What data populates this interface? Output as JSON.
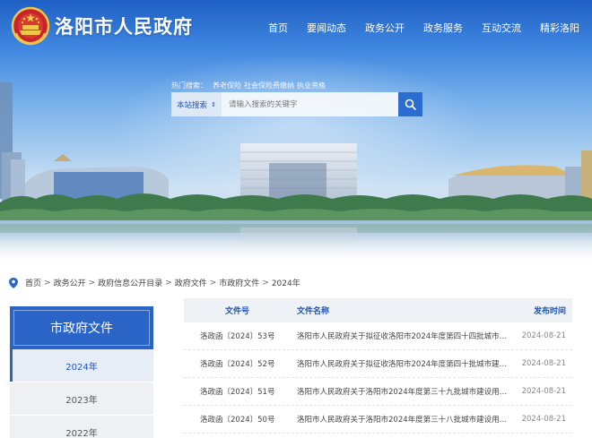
{
  "header": {
    "site_title": "洛阳市人民政府",
    "logo_icon": "national-emblem-icon",
    "nav": [
      "首页",
      "要闻动态",
      "政务公开",
      "政务服务",
      "互动交流",
      "精彩洛阳"
    ]
  },
  "search": {
    "hot_label": "热门搜索：",
    "hot_links": [
      "养老保险",
      "社会保险费缴纳",
      "执业资格"
    ],
    "scope_label": "本站搜索",
    "placeholder": "请输入搜索的关键字",
    "button_icon": "search-icon"
  },
  "breadcrumb": {
    "icon": "location-pin-icon",
    "items": [
      "首页",
      "政务公开",
      "政府信息公开目录",
      "政府文件",
      "市政府文件",
      "2024年"
    ],
    "separator": ">"
  },
  "sidebar": {
    "title": "市政府文件",
    "items": [
      {
        "label": "2024年",
        "active": true
      },
      {
        "label": "2023年",
        "active": false
      },
      {
        "label": "2022年",
        "active": false
      }
    ]
  },
  "table": {
    "headers": {
      "number": "文件号",
      "title": "文件名称",
      "date": "发布时间"
    },
    "rows": [
      {
        "number": "洛政函〔2024〕53号",
        "title": "洛阳市人民政府关于拟征收洛阳市2024年度第四十四批城市建...",
        "date": "2024-08-21"
      },
      {
        "number": "洛政函〔2024〕52号",
        "title": "洛阳市人民政府关于拟征收洛阳市2024年度第四十批城市建设...",
        "date": "2024-08-21"
      },
      {
        "number": "洛政函〔2024〕51号",
        "title": "洛阳市人民政府关于洛阳市2024年度第三十九批城市建设用地...",
        "date": "2024-08-21"
      },
      {
        "number": "洛政函〔2024〕50号",
        "title": "洛阳市人民政府关于洛阳市2024年度第三十八批城市建设用地...",
        "date": "2024-08-21"
      }
    ]
  },
  "colors": {
    "primary": "#2a64c6",
    "accent_text": "#1f56b0",
    "sidebar_bg": "#eef0f3"
  }
}
